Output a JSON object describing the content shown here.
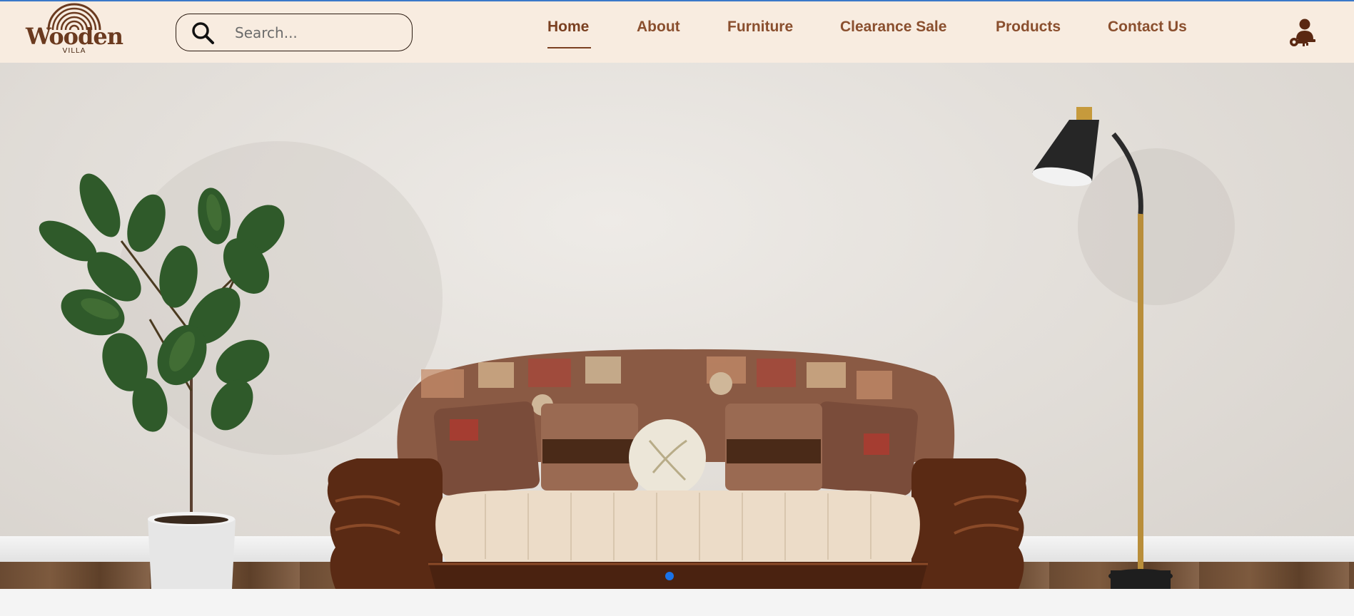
{
  "logo": {
    "word": "Wooden",
    "sub": "VILLA",
    "icon": "wood-rings-logo"
  },
  "search": {
    "placeholder": "Search...",
    "value": "",
    "icon": "search-icon"
  },
  "nav": {
    "items": [
      {
        "label": "Home",
        "active": true
      },
      {
        "label": "About",
        "active": false
      },
      {
        "label": "Furniture",
        "active": false
      },
      {
        "label": "Clearance Sale",
        "active": false
      },
      {
        "label": "Products",
        "active": false
      },
      {
        "label": "Contact Us",
        "active": false
      }
    ]
  },
  "account": {
    "icon": "user-key-icon"
  },
  "hero": {
    "image": "living-room-sofa-banner",
    "slides_indicator": {
      "active_index": 0
    }
  },
  "colors": {
    "header_bg": "#f8ece0",
    "nav_text": "#8a4f2e",
    "accent_dot": "#1a73e8"
  }
}
